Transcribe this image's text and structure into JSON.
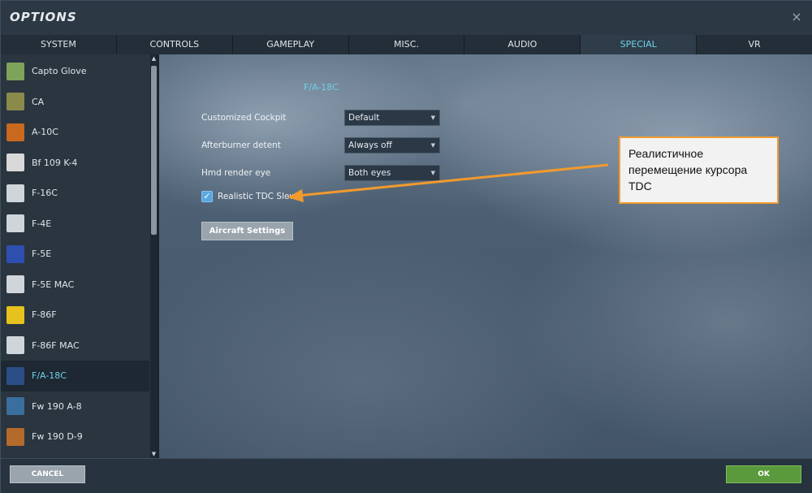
{
  "window": {
    "title": "OPTIONS",
    "close_glyph": "×"
  },
  "tabs": [
    {
      "label": "SYSTEM"
    },
    {
      "label": "CONTROLS"
    },
    {
      "label": "GAMEPLAY"
    },
    {
      "label": "MISC."
    },
    {
      "label": "AUDIO"
    },
    {
      "label": "SPECIAL",
      "active": true
    },
    {
      "label": "VR"
    }
  ],
  "sidebar": {
    "items": [
      {
        "label": "Capto Glove",
        "icon": "capto-glove-icon",
        "color": "#7ea35a"
      },
      {
        "label": "CA",
        "icon": "ca-icon",
        "color": "#8a8a4a"
      },
      {
        "label": "A-10C",
        "icon": "a10c-icon",
        "color": "#c8691e"
      },
      {
        "label": "Bf 109 K-4",
        "icon": "bf109-icon",
        "color": "#d9d9d9"
      },
      {
        "label": "F-16C",
        "icon": "dcs-icon",
        "color": "#cfd5da"
      },
      {
        "label": "F-4E",
        "icon": "dcs-icon",
        "color": "#cfd5da"
      },
      {
        "label": "F-5E",
        "icon": "f5e-icon",
        "color": "#2f4fb0"
      },
      {
        "label": "F-5E MAC",
        "icon": "dcs-icon",
        "color": "#cfd5da"
      },
      {
        "label": "F-86F",
        "icon": "f86f-icon",
        "color": "#e6c21c"
      },
      {
        "label": "F-86F MAC",
        "icon": "dcs-icon",
        "color": "#cfd5da"
      },
      {
        "label": "F/A-18C",
        "icon": "hornet-icon",
        "color": "#2b4e86",
        "active": true
      },
      {
        "label": "Fw 190 A-8",
        "icon": "fw190a8-icon",
        "color": "#3a6e9e"
      },
      {
        "label": "Fw 190 D-9",
        "icon": "fw190d9-icon",
        "color": "#b46a2a"
      }
    ]
  },
  "content": {
    "section_title": "F/A-18C",
    "settings": [
      {
        "label": "Customized Cockpit",
        "value": "Default"
      },
      {
        "label": "Afterburner detent",
        "value": "Always off"
      },
      {
        "label": "Hmd render eye",
        "value": "Both eyes"
      }
    ],
    "checkbox": {
      "label": "Realistic TDC Slew",
      "checked": true,
      "glyph": "✓"
    },
    "aircraft_settings_button": "Aircraft Settings",
    "callout_text": "Реалистичное перемещение курсора TDC",
    "accent_color": "#6fd0e8",
    "callout_border_color": "#f29a2e"
  },
  "footer": {
    "cancel_label": "CANCEL",
    "ok_label": "OK"
  },
  "glyphs": {
    "caret": "▼",
    "scroll_up": "▲",
    "scroll_down": "▼"
  }
}
